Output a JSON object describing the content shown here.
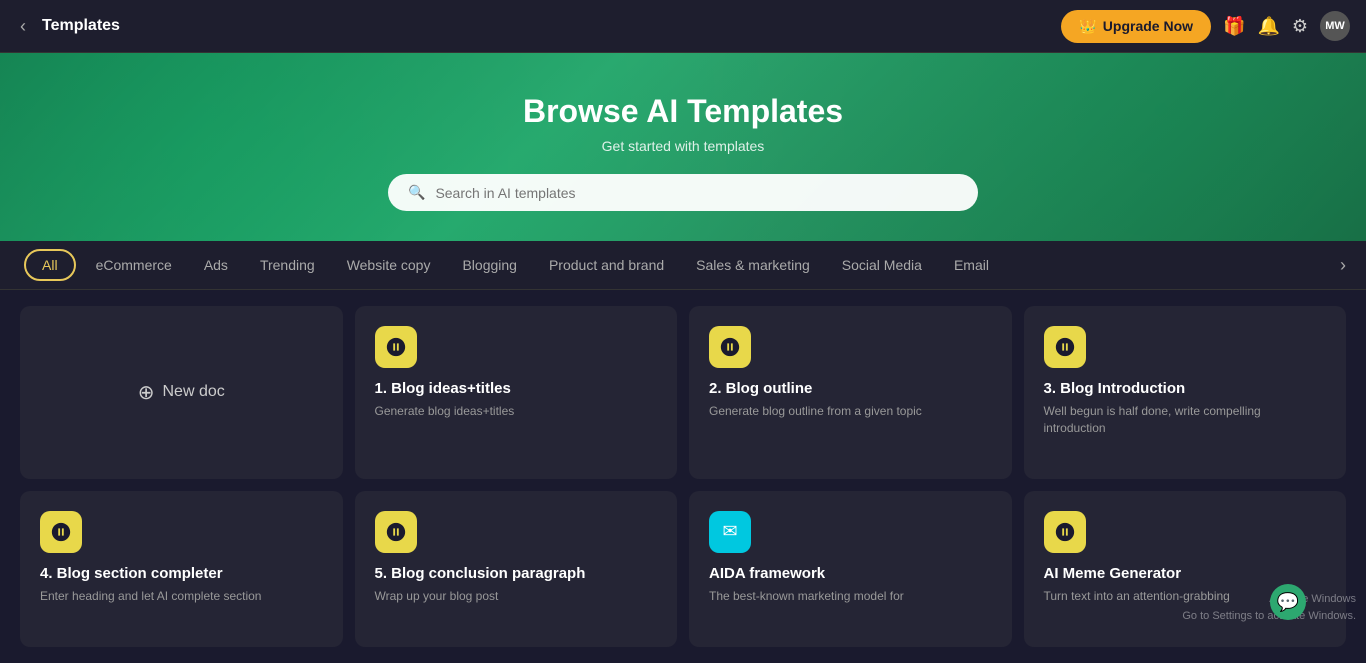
{
  "header": {
    "title": "Templates",
    "back_label": "←",
    "upgrade_label": "Upgrade Now",
    "upgrade_icon": "👑",
    "gift_icon": "🎁",
    "bell_icon": "🔔",
    "settings_icon": "⚙",
    "avatar_label": "MW"
  },
  "hero": {
    "title": "Browse AI Templates",
    "subtitle": "Get started with templates",
    "search_placeholder": "Search in AI templates"
  },
  "tabs": [
    {
      "id": "all",
      "label": "All",
      "active": true
    },
    {
      "id": "ecommerce",
      "label": "eCommerce",
      "active": false
    },
    {
      "id": "ads",
      "label": "Ads",
      "active": false
    },
    {
      "id": "trending",
      "label": "Trending",
      "active": false
    },
    {
      "id": "website-copy",
      "label": "Website copy",
      "active": false
    },
    {
      "id": "blogging",
      "label": "Blogging",
      "active": false
    },
    {
      "id": "product-brand",
      "label": "Product and brand",
      "active": false
    },
    {
      "id": "sales-marketing",
      "label": "Sales & marketing",
      "active": false
    },
    {
      "id": "social-media",
      "label": "Social Media",
      "active": false
    },
    {
      "id": "email",
      "label": "Email",
      "active": false
    }
  ],
  "new_doc_label": "New doc",
  "cards": [
    {
      "id": "blog-ideas-titles",
      "icon": "b",
      "icon_style": "yellow",
      "title": "1. Blog ideas+titles",
      "desc": "Generate blog ideas+titles"
    },
    {
      "id": "blog-outline",
      "icon": "b",
      "icon_style": "yellow",
      "title": "2. Blog outline",
      "desc": "Generate blog outline from a given topic"
    },
    {
      "id": "blog-introduction",
      "icon": "b",
      "icon_style": "yellow",
      "title": "3. Blog Introduction",
      "desc": "Well begun is half done, write compelling introduction"
    },
    {
      "id": "blog-section-completer",
      "icon": "b",
      "icon_style": "yellow",
      "title": "4. Blog section completer",
      "desc": "Enter heading and let AI complete section"
    },
    {
      "id": "blog-conclusion",
      "icon": "b",
      "icon_style": "yellow",
      "title": "5. Blog conclusion paragraph",
      "desc": "Wrap up your blog post"
    },
    {
      "id": "aida-framework",
      "icon": "✉",
      "icon_style": "cyan",
      "title": "AIDA framework",
      "desc": "The best-known marketing model for"
    },
    {
      "id": "ai-meme-generator",
      "icon": "b",
      "icon_style": "yellow",
      "title": "AI Meme Generator",
      "desc": "Turn text into an attention-grabbing"
    }
  ],
  "windows_watermark": {
    "line1": "Activate Windows",
    "line2": "Go to Settings to activate Windows."
  }
}
